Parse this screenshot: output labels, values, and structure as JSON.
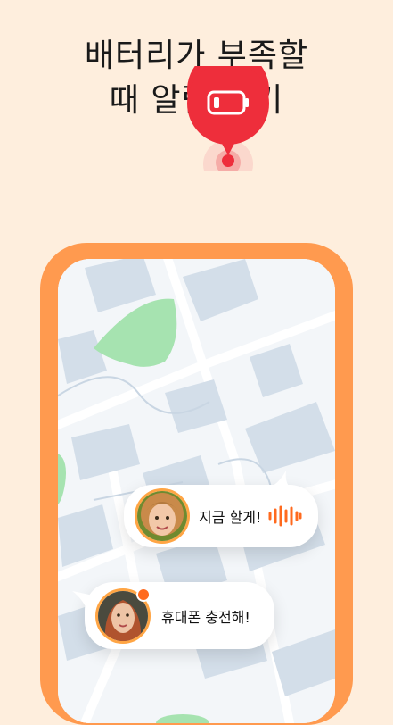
{
  "headline": {
    "line1": "배터리가 부족할",
    "line2": "때 알림 받기"
  },
  "messages": [
    {
      "text": "지금 할게!",
      "has_voice": true
    },
    {
      "text": "휴대폰 충전해!",
      "has_voice": false
    }
  ],
  "icons": {
    "pin": "low-battery-pin-icon",
    "voice": "voice-wave-icon"
  },
  "colors": {
    "background": "#FEEEDD",
    "phone_frame": "#FF9A4F",
    "pin_red": "#EE2E3B",
    "accent_orange": "#FF6A1E",
    "map_park": "#A6E3B0",
    "map_building": "#D3DEE9"
  }
}
